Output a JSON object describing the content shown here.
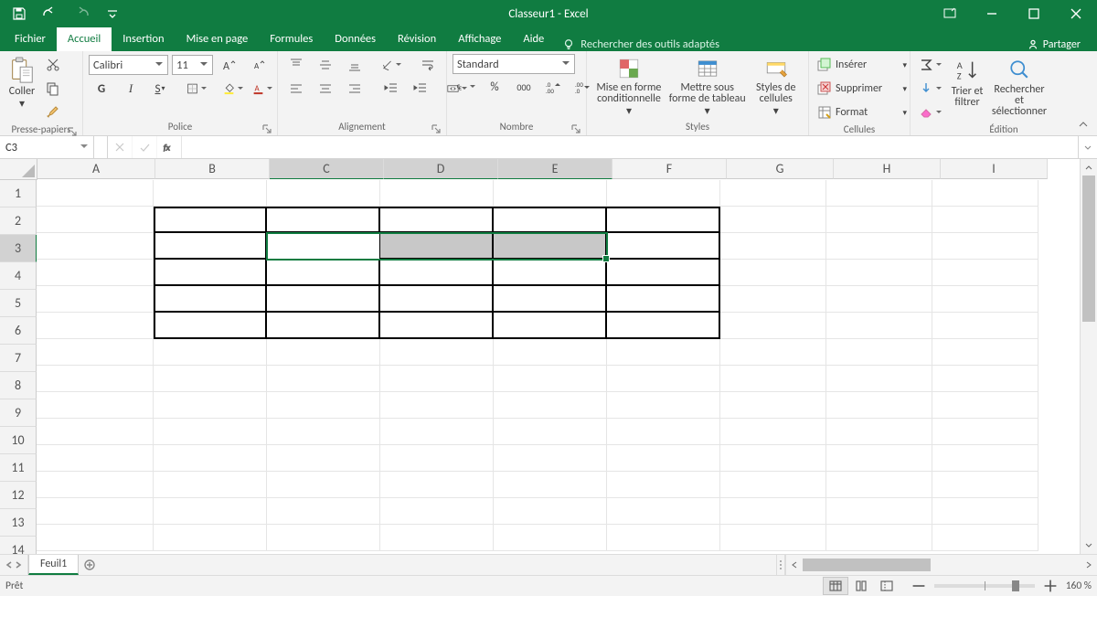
{
  "app": {
    "title": "Classeur1  -  Excel"
  },
  "tabs": {
    "fichier": "Fichier",
    "accueil": "Accueil",
    "insertion": "Insertion",
    "mise_en_page": "Mise en page",
    "formules": "Formules",
    "donnees": "Données",
    "revision": "Révision",
    "affichage": "Affichage",
    "aide": "Aide",
    "tell_me": "Rechercher des outils adaptés",
    "partager": "Partager"
  },
  "ribbon": {
    "clipboard": {
      "paste": "Coller",
      "label": "Presse-papiers"
    },
    "font": {
      "name": "Calibri",
      "size": "11",
      "label": "Police"
    },
    "alignment": {
      "label": "Alignement"
    },
    "number": {
      "format": "Standard",
      "label": "Nombre",
      "percent": "%",
      "thousand": "000"
    },
    "styles": {
      "cond": "Mise en forme conditionnelle",
      "cond2": "",
      "table": "Mettre sous forme de tableau",
      "table2": "",
      "cellstyles": "Styles de cellules",
      "cellstyles2": "",
      "label": "Styles"
    },
    "cells": {
      "insert": "Insérer",
      "delete": "Supprimer",
      "format": "Format",
      "label": "Cellules"
    },
    "editing": {
      "sort": "Trier et filtrer",
      "find": "Rechercher et sélectionner",
      "label": "Édition"
    }
  },
  "namebox": "C3",
  "sheet": {
    "name": "Feuil1"
  },
  "columns": [
    "A",
    "B",
    "C",
    "D",
    "E",
    "F",
    "G",
    "H",
    "I"
  ],
  "rows": [
    "1",
    "2",
    "3",
    "4",
    "5",
    "6",
    "7",
    "8",
    "9",
    "10",
    "11",
    "12",
    "13",
    "14"
  ],
  "selectedCols": [
    "C",
    "D",
    "E"
  ],
  "selectedRows": [
    "3"
  ],
  "status": {
    "ready": "Prêt",
    "zoom": "160 %"
  }
}
